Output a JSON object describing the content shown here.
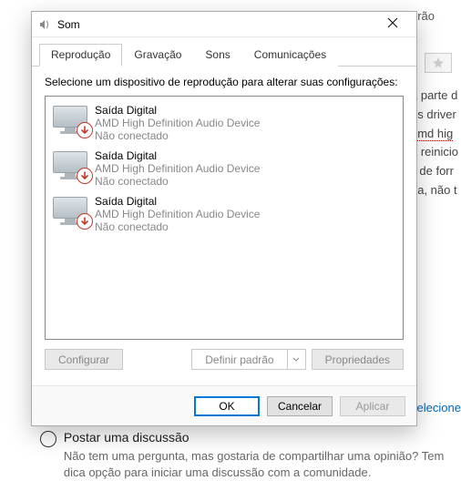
{
  "background": {
    "top_label": "drão",
    "right_lines": [
      "a parte d",
      "os driver",
      "amd hig",
      "o reinicio",
      "ii de forr",
      "na, não t"
    ],
    "selec_link": "Selecione",
    "radio_title": "Postar uma discussão",
    "radio_sub": "Não tem uma pergunta, mas gostaria de compartilhar uma opinião? Tem dica opção para iniciar uma discussão com a comunidade."
  },
  "dialog": {
    "title": "Som",
    "tabs": [
      "Reprodução",
      "Gravação",
      "Sons",
      "Comunicações"
    ],
    "active_tab": 0,
    "instructions": "Selecione um dispositivo de reprodução para alterar suas configurações:",
    "devices": [
      {
        "name": "Saída Digital",
        "desc": "AMD High Definition Audio Device",
        "status": "Não conectado"
      },
      {
        "name": "Saída Digital",
        "desc": "AMD High Definition Audio Device",
        "status": "Não conectado"
      },
      {
        "name": "Saída Digital",
        "desc": "AMD High Definition Audio Device",
        "status": "Não conectado"
      }
    ],
    "buttons": {
      "configure": "Configurar",
      "set_default": "Definir padrão",
      "properties": "Propriedades"
    },
    "footer": {
      "ok": "OK",
      "cancel": "Cancelar",
      "apply": "Aplicar"
    }
  }
}
